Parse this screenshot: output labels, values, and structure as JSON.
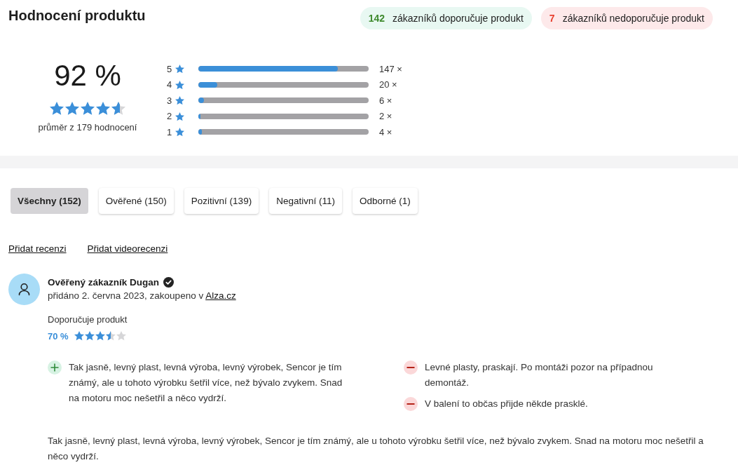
{
  "header": {
    "title": "Hodnocení produktu",
    "badges": [
      {
        "kind": "positive",
        "count": "142",
        "label": "zákazníků doporučuje produkt"
      },
      {
        "kind": "negative",
        "count": "7",
        "label": "zákazníků nedoporučuje produkt"
      }
    ]
  },
  "summary": {
    "score": "92 %",
    "stars": 4.6,
    "caption": "průměr z 179 hodnocení",
    "distribution": [
      {
        "rating": "5",
        "level": 0.82,
        "count": "147 ×"
      },
      {
        "rating": "4",
        "level": 0.11,
        "count": "20 ×"
      },
      {
        "rating": "3",
        "level": 0.034,
        "count": "6 ×"
      },
      {
        "rating": "2",
        "level": 0.011,
        "count": "2 ×"
      },
      {
        "rating": "1",
        "level": 0.022,
        "count": "4 ×"
      }
    ]
  },
  "filters": [
    {
      "label": "Všechny (152)",
      "selected": true
    },
    {
      "label": "Ověřené (150)",
      "selected": false
    },
    {
      "label": "Pozitivní (139)",
      "selected": false
    },
    {
      "label": "Negativní (11)",
      "selected": false
    },
    {
      "label": "Odborné (1)",
      "selected": false
    }
  ],
  "actions": [
    "Přidat recenzi",
    "Přidat videorecenzi"
  ],
  "review": {
    "author": "Ověřený zákazník Dugan",
    "verified": true,
    "meta": "přidáno 2. června 2023, zakoupeno v",
    "shop_link": "Alza.cz",
    "recommendation": "Doporučuje produkt",
    "score": "70 %",
    "stars": 3.5,
    "points": [
      {
        "kind": "pro",
        "text": "Tak jasně, levný plast, levná výroba, levný výrobek, Sencor je tím známý, ale u tohoto výrobku šetřil více, než bývalo zvykem. Snad na motoru moc nešetřil a něco vydrží."
      },
      {
        "kind": "con",
        "text": "Levné plasty, praskají. Po montáži pozor na případnou demontáž."
      },
      {
        "kind": "con",
        "text": "V balení to občas přijde někde prasklé."
      }
    ],
    "body": "Tak jasně, levný plast, levná výroba, levný výrobek, Sencor je tím známý, ale u tohoto výrobku šetřil více, než bývalo zvykem. Snad na motoru moc nešetřil a něco vydrží."
  }
}
